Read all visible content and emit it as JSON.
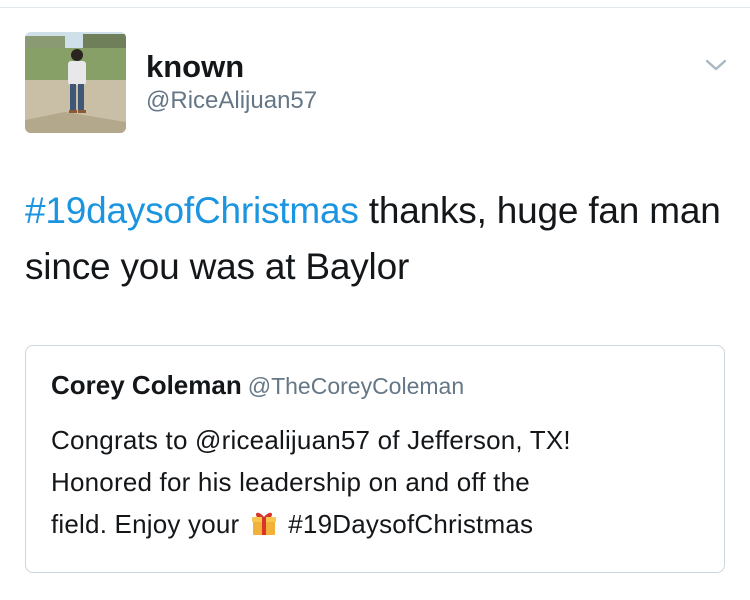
{
  "author": {
    "display_name": "known",
    "handle": "@RiceAlijuan57",
    "avatar_icon": "user-photo"
  },
  "menu": {
    "icon": "chevron-down-icon"
  },
  "tweet": {
    "hashtag": "#19daysofChristmas",
    "text_after_hashtag": " thanks, huge fan man since you was at Baylor"
  },
  "quoted_tweet": {
    "display_name": "Corey Coleman",
    "handle": "@TheCoreyColeman",
    "line1": "Congrats to @ricealijuan57 of Jefferson, TX!",
    "line2": "Honored for his leadership on and off the",
    "line3_before_icon": "field.  Enjoy your",
    "line3_after_icon": "#19DaysofChristmas",
    "emoji_icon": "gift-icon"
  },
  "colors": {
    "hashtag": "#1b95e0",
    "secondary_text": "#657786",
    "border": "#ccd6dd"
  }
}
